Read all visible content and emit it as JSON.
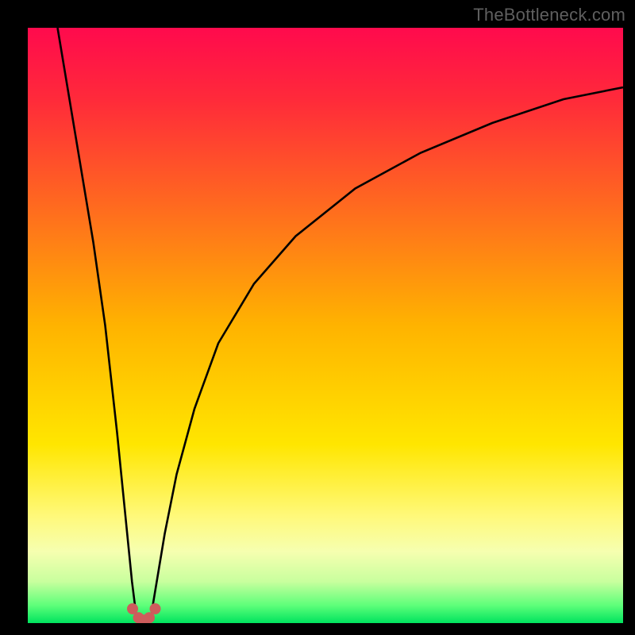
{
  "watermark": {
    "text": "TheBottleneck.com"
  },
  "chart_data": {
    "type": "line",
    "title": "",
    "xlabel": "",
    "ylabel": "",
    "xlim": [
      0,
      100
    ],
    "ylim": [
      0,
      100
    ],
    "grid": false,
    "legend": false,
    "background_gradient": {
      "stops": [
        {
          "pct": 0,
          "color": "#ff0a4d"
        },
        {
          "pct": 12,
          "color": "#ff2a3a"
        },
        {
          "pct": 30,
          "color": "#ff6a1f"
        },
        {
          "pct": 50,
          "color": "#ffb300"
        },
        {
          "pct": 70,
          "color": "#ffe600"
        },
        {
          "pct": 82,
          "color": "#fff97a"
        },
        {
          "pct": 88,
          "color": "#f6ffb0"
        },
        {
          "pct": 93,
          "color": "#c9ff9e"
        },
        {
          "pct": 97,
          "color": "#5eff7a"
        },
        {
          "pct": 100,
          "color": "#00e35e"
        }
      ]
    },
    "series": [
      {
        "name": "left-branch",
        "x": [
          5,
          7,
          9,
          11,
          13,
          15,
          16,
          17,
          17.5,
          18,
          18.3
        ],
        "y": [
          100,
          88,
          76,
          64,
          50,
          32,
          22,
          12,
          7,
          3,
          0.5
        ]
      },
      {
        "name": "right-branch",
        "x": [
          20.7,
          21,
          22,
          23,
          25,
          28,
          32,
          38,
          45,
          55,
          66,
          78,
          90,
          100
        ],
        "y": [
          0.5,
          3,
          9,
          15,
          25,
          36,
          47,
          57,
          65,
          73,
          79,
          84,
          88,
          90
        ]
      },
      {
        "name": "valley-floor",
        "x": [
          18.3,
          18.7,
          19.3,
          19.8,
          20.3,
          20.7
        ],
        "y": [
          0.5,
          0,
          0,
          0,
          0,
          0.5
        ]
      }
    ],
    "markers": {
      "name": "valley-markers",
      "color": "#cd5c5c",
      "radius_px": 7,
      "x": [
        17.6,
        18.6,
        19.5,
        20.4,
        21.4
      ],
      "y": [
        2.4,
        0.9,
        0.5,
        0.9,
        2.4
      ]
    }
  }
}
